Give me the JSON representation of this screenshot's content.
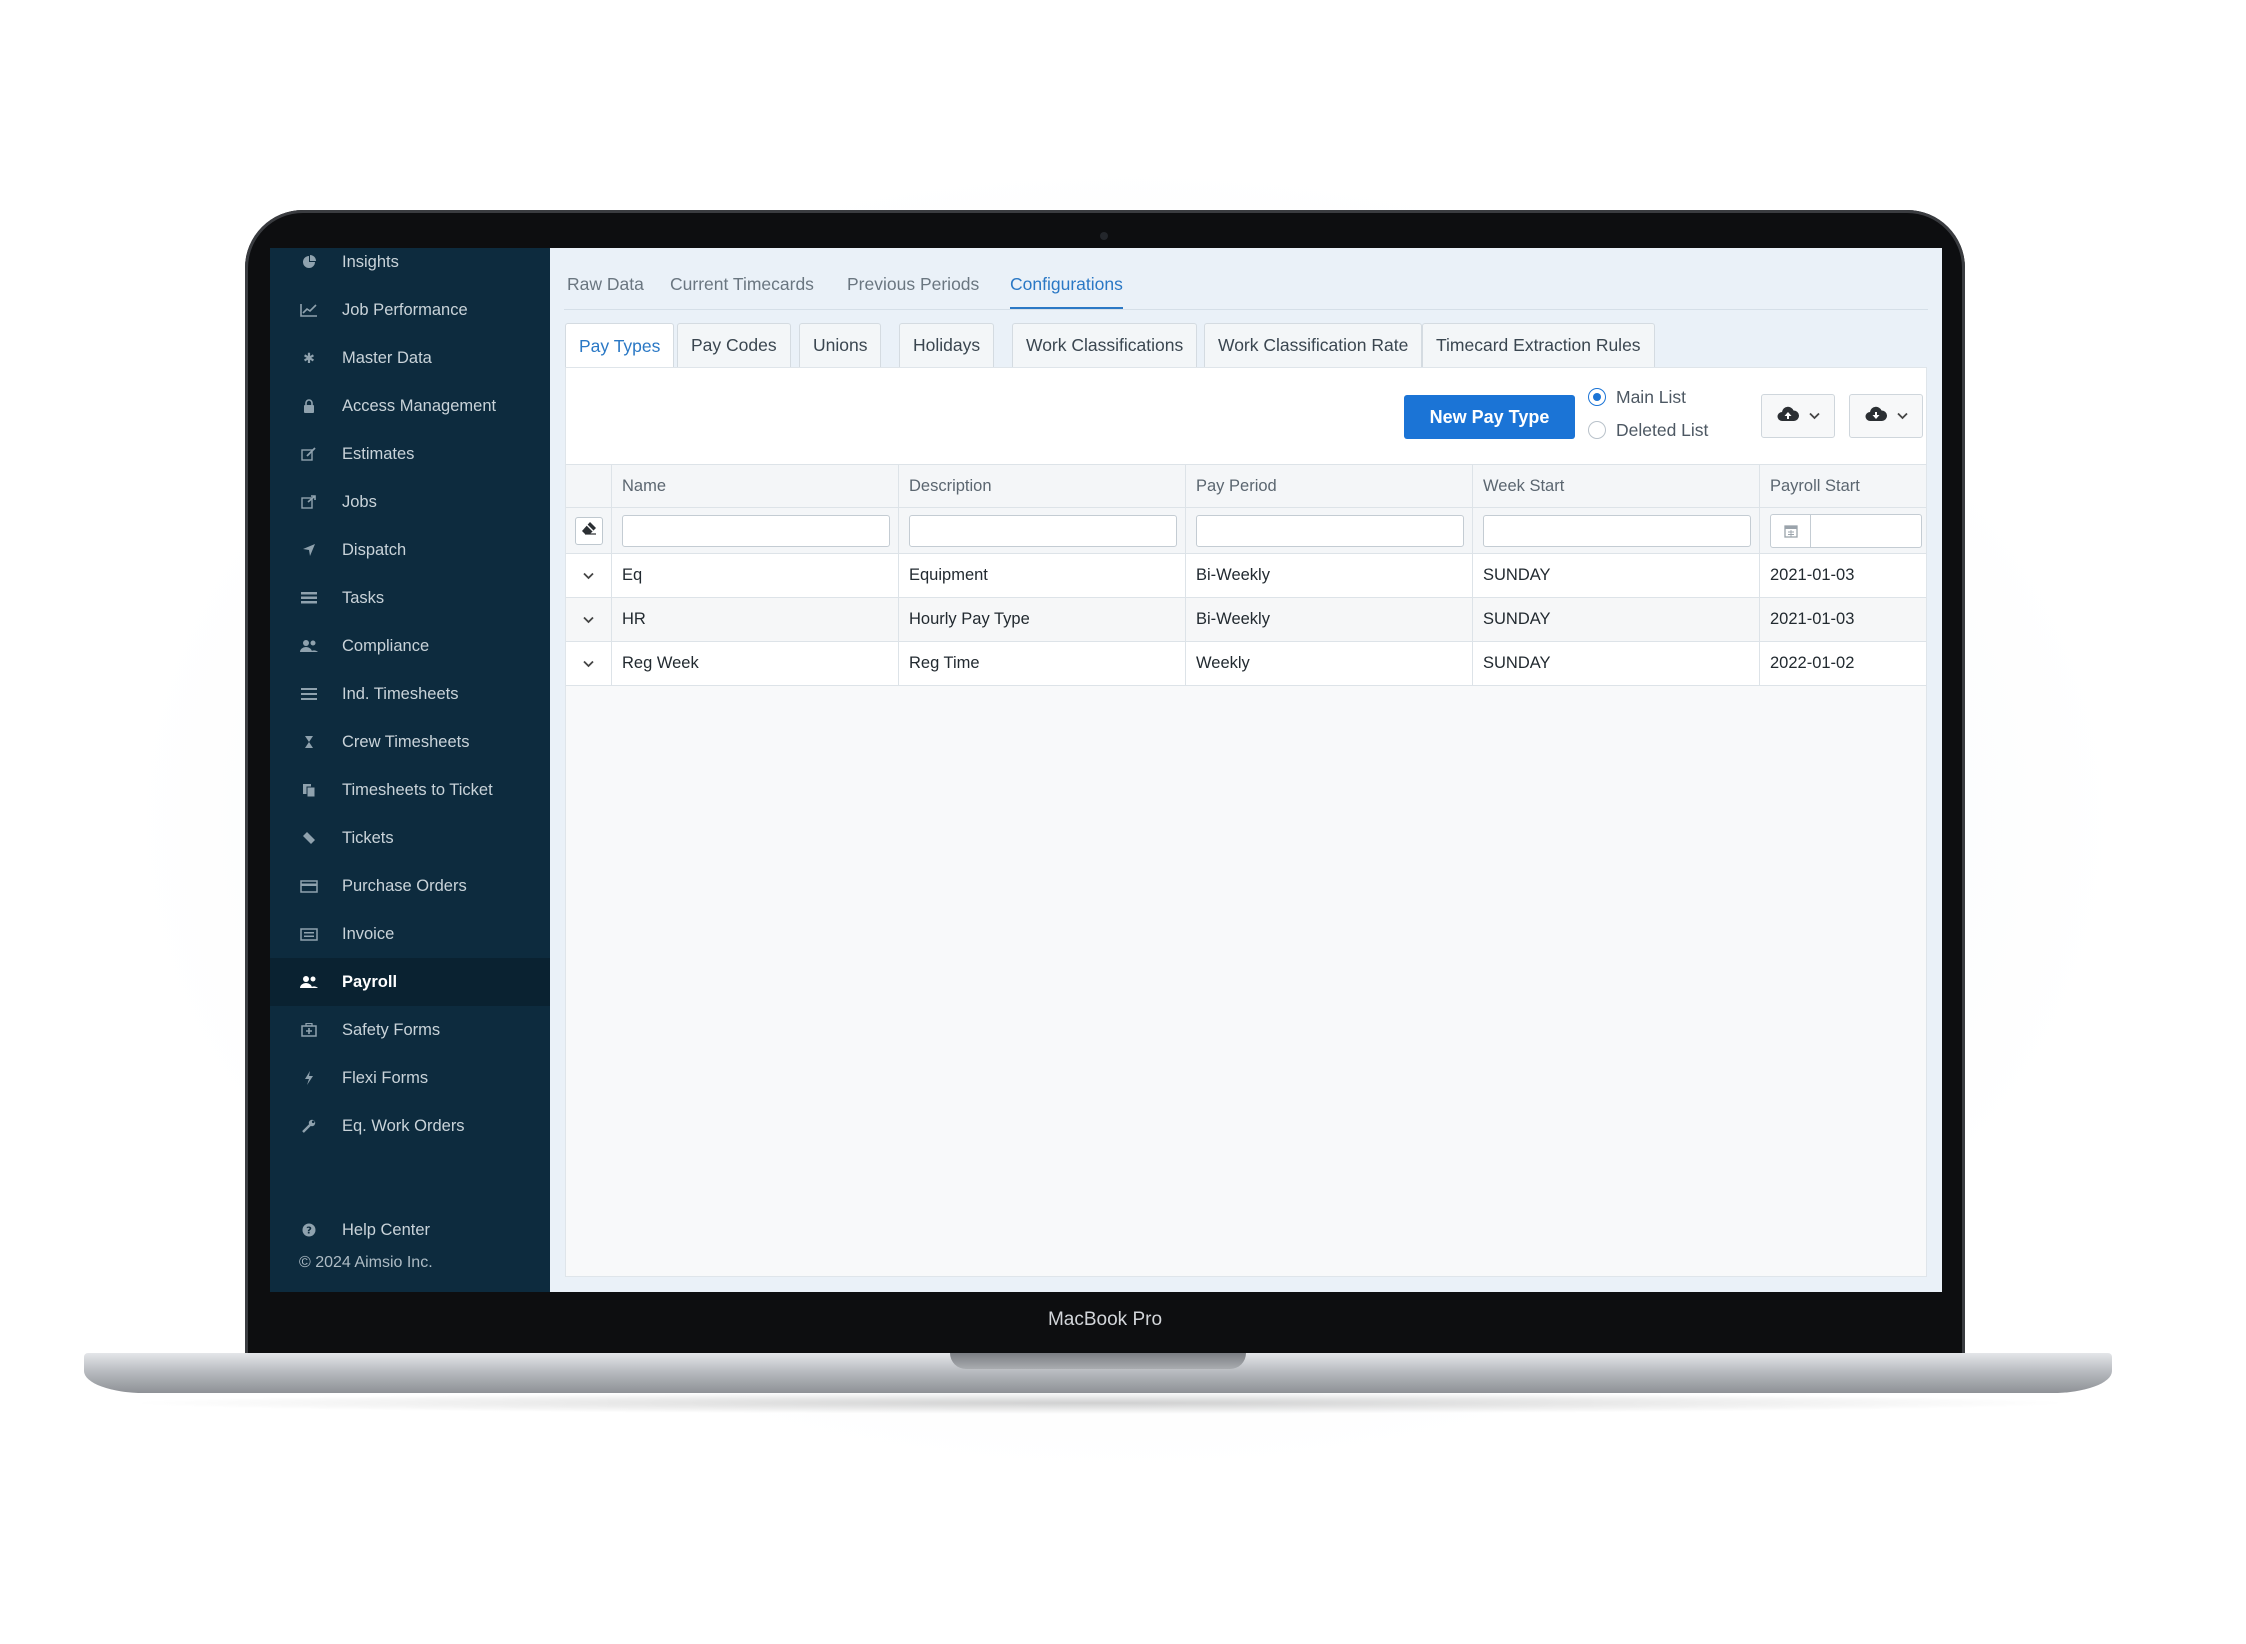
{
  "device": {
    "model_label": "MacBook Pro"
  },
  "sidebar": {
    "items": [
      {
        "label": "Insights",
        "icon": "pie-chart-icon"
      },
      {
        "label": "Job Performance",
        "icon": "line-chart-icon"
      },
      {
        "label": "Master Data",
        "icon": "gear-icon"
      },
      {
        "label": "Access Management",
        "icon": "lock-icon"
      },
      {
        "label": "Estimates",
        "icon": "edit-icon"
      },
      {
        "label": "Jobs",
        "icon": "external-link-icon"
      },
      {
        "label": "Dispatch",
        "icon": "paper-plane-icon"
      },
      {
        "label": "Tasks",
        "icon": "tasks-icon"
      },
      {
        "label": "Compliance",
        "icon": "users-icon"
      },
      {
        "label": "Ind. Timesheets",
        "icon": "list-icon"
      },
      {
        "label": "Crew Timesheets",
        "icon": "hourglass-icon"
      },
      {
        "label": "Timesheets to Ticket",
        "icon": "copy-icon"
      },
      {
        "label": "Tickets",
        "icon": "ticket-icon"
      },
      {
        "label": "Purchase Orders",
        "icon": "credit-card-icon"
      },
      {
        "label": "Invoice",
        "icon": "invoice-icon"
      },
      {
        "label": "Payroll",
        "icon": "users-icon",
        "active": true
      },
      {
        "label": "Safety Forms",
        "icon": "medkit-icon"
      },
      {
        "label": "Flexi Forms",
        "icon": "bolt-icon"
      },
      {
        "label": "Eq. Work Orders",
        "icon": "wrench-icon"
      }
    ],
    "help": {
      "label": "Help Center",
      "icon": "question-circle-icon"
    },
    "copyright": "© 2024 Aimsio Inc."
  },
  "top_tabs": [
    {
      "label": "Raw Data"
    },
    {
      "label": "Current Timecards"
    },
    {
      "label": "Previous Periods"
    },
    {
      "label": "Configurations",
      "active": true
    }
  ],
  "sub_tabs": [
    {
      "label": "Pay Types",
      "active": true
    },
    {
      "label": "Pay Codes"
    },
    {
      "label": "Unions"
    },
    {
      "label": "Holidays"
    },
    {
      "label": "Work Classifications"
    },
    {
      "label": "Work Classification Rate"
    },
    {
      "label": "Timecard Extraction Rules"
    }
  ],
  "toolbar": {
    "new_button": "New Pay Type",
    "list_options": [
      {
        "label": "Main List",
        "checked": true
      },
      {
        "label": "Deleted List",
        "checked": false
      }
    ],
    "upload_icon": "cloud-upload-icon",
    "download_icon": "cloud-download-icon"
  },
  "grid": {
    "columns": [
      "Name",
      "Description",
      "Pay Period",
      "Week Start",
      "Payroll Start"
    ],
    "rows": [
      [
        "Eq",
        "Equipment",
        "Bi-Weekly",
        "SUNDAY",
        "2021-01-03"
      ],
      [
        "HR",
        "Hourly Pay Type",
        "Bi-Weekly",
        "SUNDAY",
        "2021-01-03"
      ],
      [
        "Reg Week",
        "Reg Time",
        "Weekly",
        "SUNDAY",
        "2022-01-02"
      ]
    ]
  },
  "colors": {
    "sidebar_bg": "#0d2b3e",
    "accent": "#1b74d6",
    "link": "#2a78c5"
  }
}
